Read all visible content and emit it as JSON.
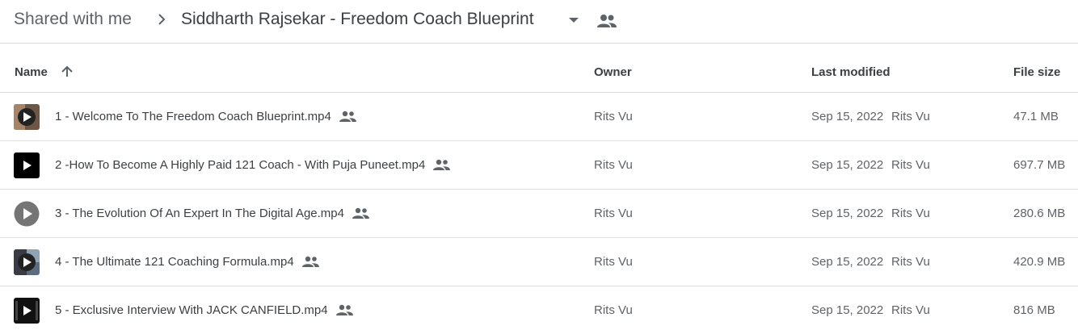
{
  "breadcrumb": {
    "root": "Shared with me",
    "current": "Siddharth Rajsekar - Freedom Coach Blueprint"
  },
  "columns": {
    "name": "Name",
    "owner": "Owner",
    "last_modified": "Last modified",
    "file_size": "File size"
  },
  "files": [
    {
      "name": "1 - Welcome To The Freedom Coach Blueprint.mp4",
      "owner": "Rits Vu",
      "modified_date": "Sep 15, 2022",
      "modified_by": "Rits Vu",
      "size": "47.1 MB"
    },
    {
      "name": "2 -How To Become A Highly Paid 121 Coach - With Puja Puneet.mp4",
      "owner": "Rits Vu",
      "modified_date": "Sep 15, 2022",
      "modified_by": "Rits Vu",
      "size": "697.7 MB"
    },
    {
      "name": "3 - The Evolution Of An Expert In The Digital Age.mp4",
      "owner": "Rits Vu",
      "modified_date": "Sep 15, 2022",
      "modified_by": "Rits Vu",
      "size": "280.6 MB"
    },
    {
      "name": "4 - The Ultimate 121 Coaching Formula.mp4",
      "owner": "Rits Vu",
      "modified_date": "Sep 15, 2022",
      "modified_by": "Rits Vu",
      "size": "420.9 MB"
    },
    {
      "name": "5 - Exclusive Interview With JACK CANFIELD.mp4",
      "owner": "Rits Vu",
      "modified_date": "Sep 15, 2022",
      "modified_by": "Rits Vu",
      "size": "816 MB"
    }
  ],
  "icons": {
    "breadcrumb_separator": "chevron-right-icon",
    "dropdown": "caret-down-icon",
    "shared": "people-icon",
    "sort": "arrow-up-icon",
    "file_thumbnail": "video-play-icon"
  },
  "colors": {
    "divider": "#dadce0",
    "text_primary": "#3c4043",
    "text_secondary": "#5f6368"
  }
}
